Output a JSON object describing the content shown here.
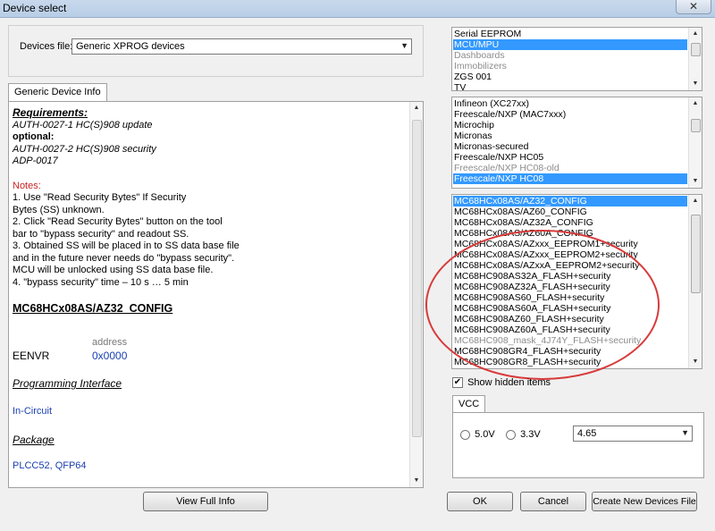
{
  "window": {
    "title": "Device select",
    "close_glyph": "✕"
  },
  "devices_file": {
    "label": "Devices file:",
    "value": "Generic XPROG devices"
  },
  "tab": {
    "label": "Generic Device Info"
  },
  "info": {
    "requirements_title": "Requirements:",
    "req1": "AUTH-0027-1 HC(S)908  update",
    "optional_label": "optional:",
    "opt1": "AUTH-0027-2 HC(S)908  security",
    "opt2": "ADP-0017",
    "notes_label": "Notes:",
    "notes": [
      "1. Use \"Read Security Bytes\" If Security",
      "Bytes (SS) unknown.",
      "2. Click \"Read Security Bytes\" button on the tool",
      "bar to \"bypass security\" and readout SS.",
      "3. Obtained SS will be placed in to SS data base file",
      "and in the future never needs do \"bypass security\".",
      "MCU will be unlocked using SS data base file.",
      "4. \"bypass security\" time – 10 s … 5 min"
    ],
    "device_title": "MC68HCx08AS/AZ32_CONFIG",
    "address_label": "address",
    "reg_name": "EENVR",
    "reg_addr": "0x0000",
    "prog_iface_label": "Programming Interface",
    "prog_iface_value": "In-Circuit",
    "package_label": "Package",
    "package_value": "PLCC52, QFP64"
  },
  "buttons": {
    "view_full_info": "View Full Info",
    "ok": "OK",
    "cancel": "Cancel",
    "create_new": "Create New Devices File"
  },
  "list_categories": {
    "items": [
      {
        "label": "Serial EEPROM",
        "state": "normal"
      },
      {
        "label": "MCU/MPU",
        "state": "selected"
      },
      {
        "label": "Dashboards",
        "state": "gray"
      },
      {
        "label": "Immobilizers",
        "state": "gray"
      },
      {
        "label": "ZGS 001",
        "state": "normal"
      },
      {
        "label": "TV",
        "state": "normal"
      }
    ]
  },
  "list_vendors": {
    "items": [
      {
        "label": "Infineon (XC27xx)",
        "state": "normal"
      },
      {
        "label": "Freescale/NXP (MAC7xxx)",
        "state": "normal"
      },
      {
        "label": "Microchip",
        "state": "normal"
      },
      {
        "label": "Micronas",
        "state": "normal"
      },
      {
        "label": "Micronas-secured",
        "state": "normal"
      },
      {
        "label": "Freescale/NXP HC05",
        "state": "normal"
      },
      {
        "label": "Freescale/NXP HC08-old",
        "state": "gray"
      },
      {
        "label": "Freescale/NXP HC08",
        "state": "selected"
      }
    ]
  },
  "list_devices": {
    "items": [
      {
        "label": "MC68HCx08AS/AZ32_CONFIG",
        "state": "selected"
      },
      {
        "label": "MC68HCx08AS/AZ60_CONFIG",
        "state": "normal"
      },
      {
        "label": "MC68HCx08AS/AZ32A_CONFIG",
        "state": "normal"
      },
      {
        "label": "MC68HCx08AS/AZ60A_CONFIG",
        "state": "normal"
      },
      {
        "label": "MC68HCx08AS/AZxxx_EEPROM1+security",
        "state": "normal"
      },
      {
        "label": "MC68HCx08AS/AZxxx_EEPROM2+security",
        "state": "normal"
      },
      {
        "label": "MC68HCx08AS/AZxxA_EEPROM2+security",
        "state": "normal"
      },
      {
        "label": "MC68HC908AS32A_FLASH+security",
        "state": "normal"
      },
      {
        "label": "MC68HC908AZ32A_FLASH+security",
        "state": "normal"
      },
      {
        "label": "MC68HC908AS60_FLASH+security",
        "state": "normal"
      },
      {
        "label": "MC68HC908AS60A_FLASH+security",
        "state": "normal"
      },
      {
        "label": "MC68HC908AZ60_FLASH+security",
        "state": "normal"
      },
      {
        "label": "MC68HC908AZ60A_FLASH+security",
        "state": "normal"
      },
      {
        "label": "MC68HC908_mask_4J74Y_FLASH+security",
        "state": "gray"
      },
      {
        "label": "MC68HC908GR4_FLASH+security",
        "state": "normal"
      },
      {
        "label": "MC68HC908GR8_FLASH+security",
        "state": "normal"
      }
    ]
  },
  "show_hidden": {
    "label": "Show hidden items",
    "checked": true,
    "check_glyph": "✔"
  },
  "vcc": {
    "tab_label": "VCC",
    "opt1": "5.0V",
    "opt2": "3.3V",
    "value": "4.65"
  },
  "colors": {
    "selection": "#3399ff",
    "annotation": "#d83a3a",
    "blue_text": "#1a3fb0",
    "notes_red": "#cc2222"
  },
  "icons": {
    "dropdown": "chevron-down-icon",
    "scroll_up": "arrow-up-icon",
    "scroll_down": "arrow-down-icon",
    "close": "close-icon"
  }
}
